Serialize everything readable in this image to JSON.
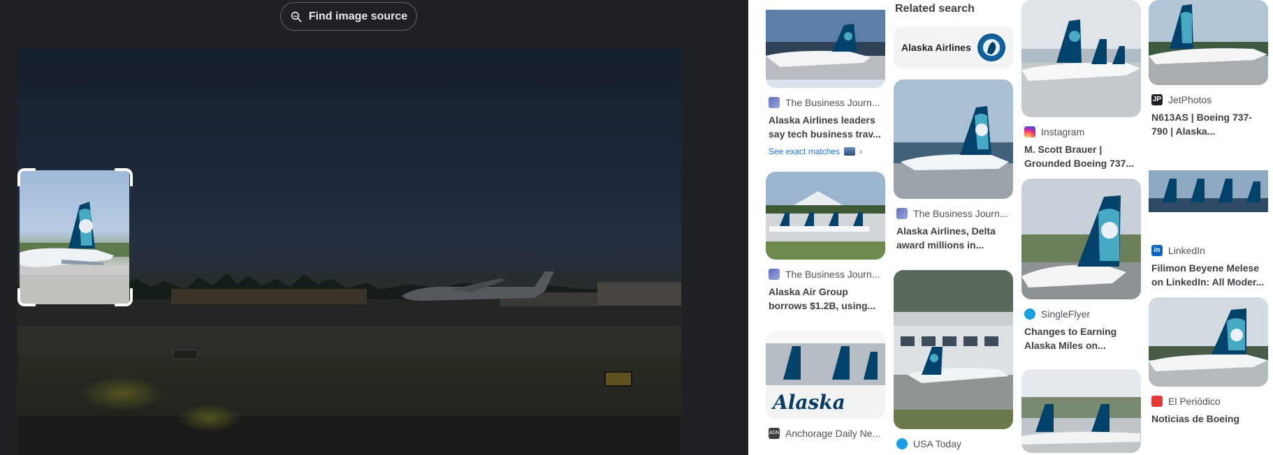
{
  "viewer": {
    "find_source_label": "Find image source",
    "find_source_icon": "image-search-icon"
  },
  "results": {
    "related_search_heading": "Related search",
    "related_chip_label": "Alaska Airlines",
    "see_exact_matches": "See exact matches",
    "cards": {
      "c1": {
        "source": "The Business Journ...",
        "title": "Alaska Airlines leaders say tech business trav..."
      },
      "c2": {
        "source": "The Business Journ...",
        "title": "Alaska Air Group borrows $1.2B, using..."
      },
      "c3": {
        "source": "Anchorage Daily Ne...",
        "title": ""
      },
      "c4": {
        "source": "The Business Journ...",
        "title": "Alaska Airlines, Delta award millions in..."
      },
      "c5": {
        "source": "USA Today",
        "title": ""
      },
      "c6": {
        "source": "Instagram",
        "title": "M. Scott Brauer | Grounded Boeing 737..."
      },
      "c7": {
        "source": "SingleFlyer",
        "title": "Changes to Earning Alaska Miles on..."
      },
      "c8": {
        "source": "JetPhotos",
        "title": "N613AS | Boeing 737-790 | Alaska..."
      },
      "c9": {
        "source": "LinkedIn",
        "title": "Filimon Beyene Melese on LinkedIn: All Moder..."
      },
      "c10": {
        "source": "El Periódico",
        "title": "Noticias de Boeing"
      }
    }
  },
  "colors": {
    "viewer_bg": "#202124",
    "alaska_navy": "#01426a",
    "alaska_teal": "#48a9c5",
    "link_blue": "#1a73e8"
  }
}
